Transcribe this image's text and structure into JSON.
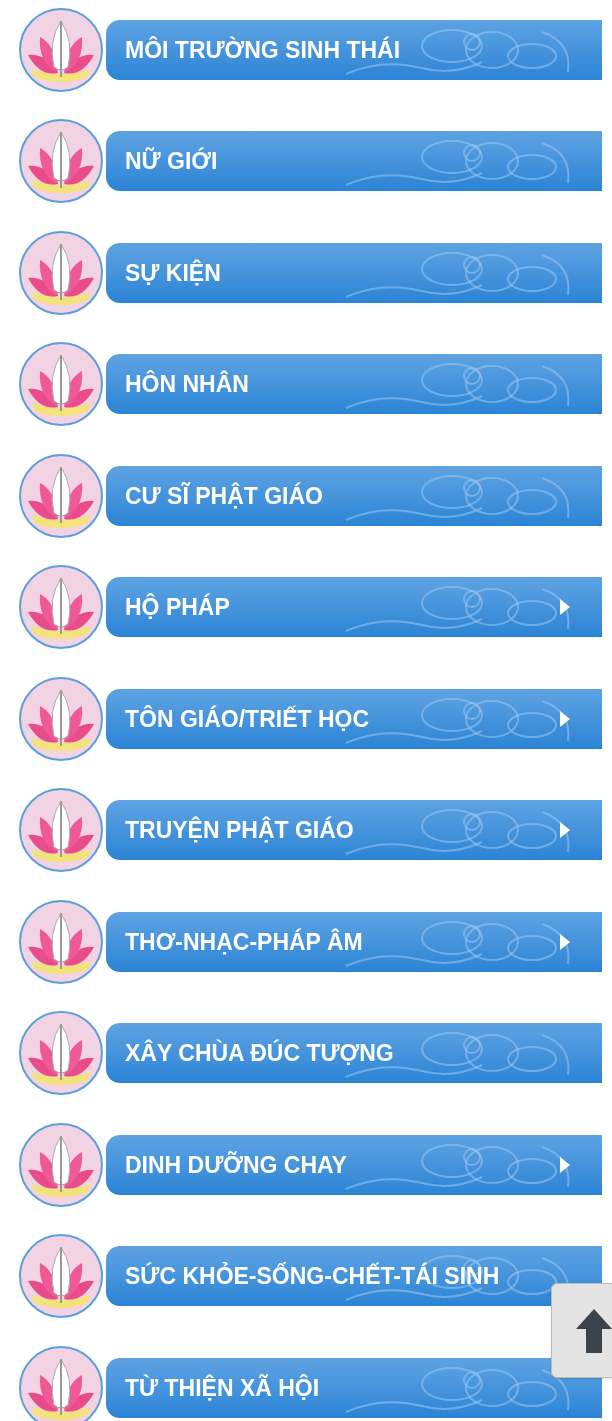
{
  "menu": [
    {
      "label": "MÔI TRƯỜNG SINH THÁI",
      "has_submenu": false
    },
    {
      "label": "NỮ GIỚI",
      "has_submenu": false
    },
    {
      "label": "SỰ KIỆN",
      "has_submenu": false
    },
    {
      "label": "HÔN NHÂN",
      "has_submenu": false
    },
    {
      "label": "CƯ SĨ PHẬT GIÁO",
      "has_submenu": false
    },
    {
      "label": "HỘ PHÁP",
      "has_submenu": true
    },
    {
      "label": "TÔN GIÁO/TRIẾT HỌC",
      "has_submenu": true
    },
    {
      "label": "TRUYỆN PHẬT GIÁO",
      "has_submenu": true
    },
    {
      "label": "THƠ-NHẠC-PHÁP ÂM",
      "has_submenu": true
    },
    {
      "label": "XÂY CHÙA ĐÚC TƯỢNG",
      "has_submenu": false
    },
    {
      "label": "DINH DƯỠNG CHAY",
      "has_submenu": true
    },
    {
      "label": "SỨC KHỎE-SỐNG-CHẾT-TÁI SINH",
      "has_submenu": false
    },
    {
      "label": "TỪ THIỆN XÃ HỘI",
      "has_submenu": false
    }
  ],
  "back_to_top": {
    "visible": true
  }
}
